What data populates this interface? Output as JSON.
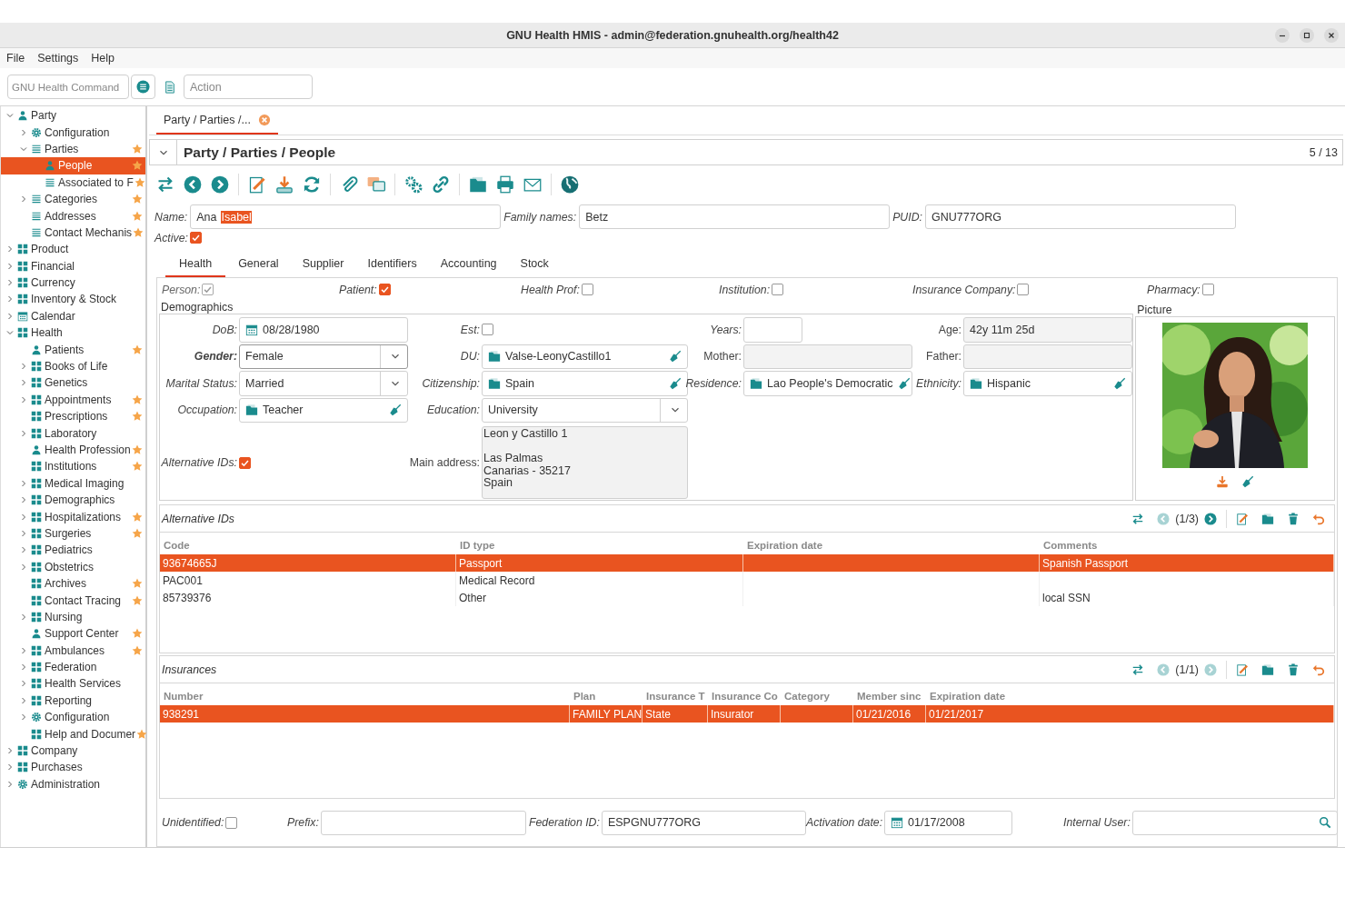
{
  "window": {
    "title": "GNU Health HMIS - admin@federation.gnuhealth.org/health42"
  },
  "menu": [
    "File",
    "Settings",
    "Help"
  ],
  "command_bar": {
    "command_placeholder": "GNU Health Command",
    "action_placeholder": "Action"
  },
  "sidebar": {
    "items": [
      {
        "label": "Party",
        "expanded": true,
        "starred": false,
        "selected": false,
        "children": [
          {
            "label": "Configuration",
            "expanded": false,
            "starred": false,
            "selected": false
          },
          {
            "label": "Parties",
            "expanded": true,
            "starred": true,
            "selected": false,
            "children": [
              {
                "label": "People",
                "starred": true,
                "selected": true
              },
              {
                "label": "Associated to F",
                "starred": true,
                "selected": false
              }
            ]
          },
          {
            "label": "Categories",
            "expanded": false,
            "starred": true,
            "selected": false
          },
          {
            "label": "Addresses",
            "starred": true,
            "selected": false
          },
          {
            "label": "Contact Mechanis",
            "starred": true,
            "selected": false
          }
        ]
      },
      {
        "label": "Product",
        "expanded": false,
        "starred": false,
        "selected": false
      },
      {
        "label": "Financial",
        "expanded": false,
        "starred": false,
        "selected": false
      },
      {
        "label": "Currency",
        "expanded": false,
        "starred": false,
        "selected": false
      },
      {
        "label": "Inventory & Stock",
        "expanded": false,
        "starred": false,
        "selected": false
      },
      {
        "label": "Calendar",
        "expanded": false,
        "starred": false,
        "selected": false
      },
      {
        "label": "Health",
        "expanded": true,
        "starred": false,
        "selected": false,
        "children": [
          {
            "label": "Patients",
            "starred": true,
            "selected": false
          },
          {
            "label": "Books of Life",
            "expanded": false,
            "starred": false,
            "selected": false
          },
          {
            "label": "Genetics",
            "expanded": false,
            "starred": false,
            "selected": false
          },
          {
            "label": "Appointments",
            "expanded": false,
            "starred": true,
            "selected": false
          },
          {
            "label": "Prescriptions",
            "starred": true,
            "selected": false
          },
          {
            "label": "Laboratory",
            "expanded": false,
            "starred": false,
            "selected": false
          },
          {
            "label": "Health Profession",
            "starred": true,
            "selected": false
          },
          {
            "label": "Institutions",
            "starred": true,
            "selected": false
          },
          {
            "label": "Medical Imaging",
            "expanded": false,
            "starred": false,
            "selected": false
          },
          {
            "label": "Demographics",
            "expanded": false,
            "starred": false,
            "selected": false
          },
          {
            "label": "Hospitalizations",
            "expanded": false,
            "starred": true,
            "selected": false
          },
          {
            "label": "Surgeries",
            "expanded": false,
            "starred": true,
            "selected": false
          },
          {
            "label": "Pediatrics",
            "expanded": false,
            "starred": false,
            "selected": false
          },
          {
            "label": "Obstetrics",
            "expanded": false,
            "starred": false,
            "selected": false
          },
          {
            "label": "Archives",
            "starred": true,
            "selected": false
          },
          {
            "label": "Contact Tracing",
            "starred": true,
            "selected": false
          },
          {
            "label": "Nursing",
            "expanded": false,
            "starred": false,
            "selected": false
          },
          {
            "label": "Support Center",
            "starred": true,
            "selected": false
          },
          {
            "label": "Ambulances",
            "expanded": false,
            "starred": true,
            "selected": false
          },
          {
            "label": "Federation",
            "expanded": false,
            "starred": false,
            "selected": false
          },
          {
            "label": "Health Services",
            "expanded": false,
            "starred": false,
            "selected": false
          },
          {
            "label": "Reporting",
            "expanded": false,
            "starred": false,
            "selected": false
          },
          {
            "label": "Configuration",
            "expanded": false,
            "starred": false,
            "selected": false
          },
          {
            "label": "Help and Documer",
            "starred": true,
            "selected": false
          }
        ]
      },
      {
        "label": "Company",
        "expanded": false,
        "starred": false,
        "selected": false
      },
      {
        "label": "Purchases",
        "expanded": false,
        "starred": false,
        "selected": false
      },
      {
        "label": "Administration",
        "expanded": false,
        "starred": false,
        "selected": false
      }
    ]
  },
  "tabs": [
    {
      "label": "Party / Parties /...",
      "selected": true
    }
  ],
  "form": {
    "title": "Party / Parties / People",
    "record_counter": "5 / 13",
    "name_fields": [
      {
        "label": "Name:",
        "parts": [
          {
            "text": "Ana",
            "selected": false
          },
          {
            "text": "Isabel",
            "selected": true
          }
        ]
      },
      {
        "label": "Family names:",
        "value": "Betz"
      },
      {
        "label": "PUID:",
        "value": "GNU777ORG"
      }
    ],
    "active": {
      "label": "Active:",
      "checked": true
    },
    "notebook": {
      "tabs": [
        {
          "label": "Health",
          "selected": true
        },
        {
          "label": "General",
          "selected": false
        },
        {
          "label": "Supplier",
          "selected": false
        },
        {
          "label": "Identifiers",
          "selected": false
        },
        {
          "label": "Accounting",
          "selected": false
        },
        {
          "label": "Stock",
          "selected": false
        }
      ],
      "flags": [
        {
          "label": "Person:",
          "checked": true,
          "readonly": true
        },
        {
          "label": "Patient:",
          "checked": true,
          "readonly": false
        },
        {
          "label": "Health Prof:",
          "checked": false,
          "readonly": false
        },
        {
          "label": "Institution:",
          "checked": false,
          "readonly": false
        },
        {
          "label": "Insurance Company:",
          "checked": false,
          "readonly": false
        },
        {
          "label": "Pharmacy:",
          "checked": false,
          "readonly": false
        }
      ],
      "demographics": {
        "title": "Demographics",
        "rows": [
          [
            {
              "label": "DoB:",
              "kind": "date",
              "value": "08/28/1980",
              "required": false,
              "readonly": false
            },
            {
              "label": "Est:",
              "kind": "checkbox",
              "checked": false,
              "required": false,
              "readonly": false
            },
            {
              "label": "Years:",
              "kind": "number",
              "required": false,
              "readonly": false
            },
            {
              "label": "Age:",
              "kind": "text",
              "value": "42y 11m 25d",
              "required": false,
              "readonly": true
            }
          ],
          [
            {
              "label": "Gender:",
              "kind": "select",
              "value": "Female",
              "required": true,
              "readonly": false
            },
            {
              "label": "DU:",
              "kind": "relation",
              "value": "Valse-LeonyCastillo1",
              "required": false,
              "readonly": false
            },
            {
              "label": "Mother:",
              "kind": "text",
              "required": false,
              "readonly": true
            },
            {
              "label": "Father:",
              "kind": "text",
              "required": false,
              "readonly": true
            }
          ],
          [
            {
              "label": "Marital Status:",
              "kind": "select",
              "value": "Married",
              "required": false,
              "readonly": false
            },
            {
              "label": "Citizenship:",
              "kind": "relation",
              "value": "Spain",
              "required": false,
              "readonly": false
            },
            {
              "label": "Residence:",
              "kind": "relation",
              "value": "Lao People's Democratic",
              "required": false,
              "readonly": false
            },
            {
              "label": "Ethnicity:",
              "kind": "relation",
              "value": "Hispanic",
              "required": false,
              "readonly": false
            }
          ],
          [
            {
              "label": "Occupation:",
              "kind": "relation",
              "value": "Teacher",
              "required": false,
              "readonly": false
            },
            {
              "label": "Education:",
              "kind": "select",
              "value": "University",
              "required": false,
              "readonly": false
            }
          ],
          [
            {
              "label": "Alternative IDs:",
              "kind": "checkbox",
              "checked": true,
              "required": false,
              "readonly": false
            },
            {
              "label": "Main address:",
              "kind": "textarea",
              "value": "Leon y Castillo 1\n\nLas Palmas\nCanarias - 35217\nSpain",
              "required": false,
              "readonly": true
            }
          ]
        ]
      },
      "picture": {
        "title": "Picture",
        "kind": "picture"
      },
      "tables": [
        {
          "title": "Alternative IDs",
          "counter": "(1/3)",
          "previous_disabled": true,
          "next_disabled": false,
          "columns": [
            "Code",
            "ID type",
            "Expiration date",
            "Comments"
          ],
          "rows": [
            {
              "cells": [
                "93674665J",
                "Passport",
                null,
                "Spanish Passport"
              ],
              "selected": true
            },
            {
              "cells": [
                "PAC001",
                "Medical Record"
              ],
              "selected": false
            },
            {
              "cells": [
                "85739376",
                "Other",
                null,
                "local SSN"
              ],
              "selected": false
            }
          ]
        },
        {
          "title": "Insurances",
          "counter": "(1/1)",
          "previous_disabled": true,
          "next_disabled": true,
          "columns": [
            "Number",
            "Plan",
            "Insurance T",
            "Insurance Co",
            "Category",
            "Member sinc",
            "Expiration date"
          ],
          "rows": [
            {
              "cells": [
                "938291",
                "FAMILY PLAN",
                "State",
                "Insurator",
                null,
                "01/21/2016",
                "01/21/2017"
              ],
              "selected": true
            }
          ]
        }
      ],
      "footer_fields": [
        {
          "label": "Unidentified:",
          "kind": "checkbox",
          "checked": false
        },
        {
          "label": "Prefix:",
          "kind": "text"
        },
        {
          "label": "Federation ID:",
          "kind": "text",
          "value": "ESPGNU777ORG"
        },
        {
          "label": "Activation date:",
          "kind": "date",
          "value": "01/17/2008"
        },
        {
          "label": "Internal User:",
          "kind": "search"
        }
      ]
    }
  }
}
